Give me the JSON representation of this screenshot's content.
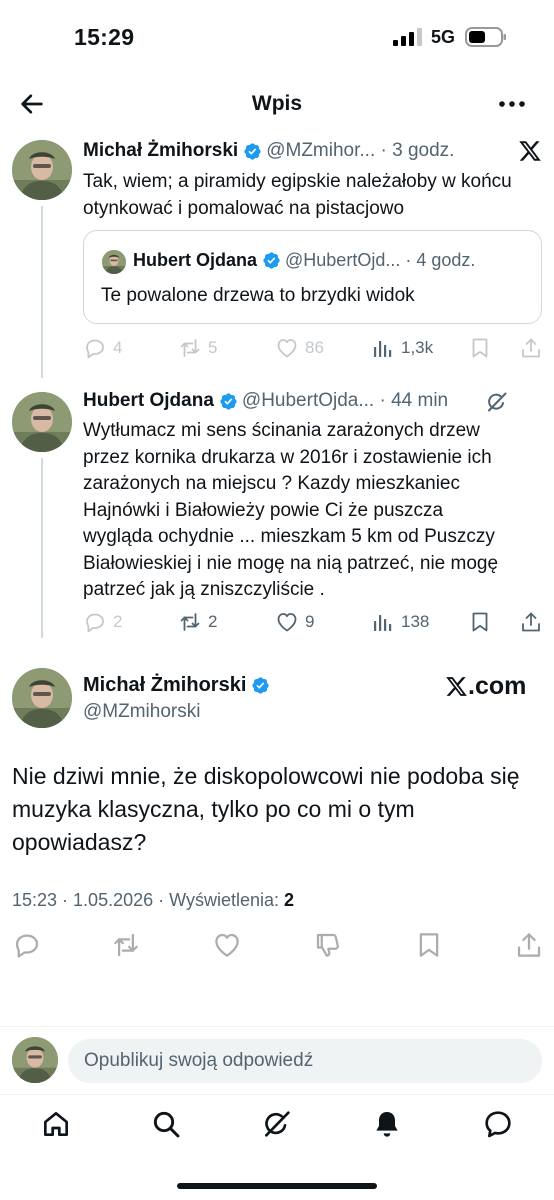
{
  "status_bar": {
    "time": "15:29",
    "network": "5G"
  },
  "header": {
    "title": "Wpis"
  },
  "post1": {
    "author": "Michał Żmihorski",
    "handle_time": "@MZmihor... · 3 godz.",
    "text": "Tak, wiem; a piramidy egipskie należałoby w końcu otynkować i pomalować na pistacjowo",
    "quote": {
      "author": "Hubert Ojdana",
      "handle_time": "@HubertOjd... · 4 godz.",
      "text": "Te powalone drzewa to brzydki widok"
    },
    "counts": {
      "replies": "4",
      "reposts": "5",
      "likes": "86",
      "views": "1,3k"
    }
  },
  "post2": {
    "author": "Hubert Ojdana",
    "handle_time": "@HubertOjda... · 44 min",
    "lines": [
      "Wytłumacz mi sens ścinania zarażonych drzew",
      "przez kornika drukarza w 2016r i zostawienie ich",
      "zarażonych na miejscu ? Kazdy mieszkaniec",
      "Hajnówki i Białowieży powie Ci że puszcza",
      "wygląda ochydnie ... mieszkam 5 km od Puszczy",
      "Białowieskiej i nie mogę na nią patrzeć, nie mogę",
      "patrzeć jak ją zniszczyliście ."
    ],
    "counts": {
      "replies": "2",
      "reposts": "2",
      "likes": "9",
      "views": "138"
    }
  },
  "main_post": {
    "author": "Michał Żmihorski",
    "handle": "@MZmihorski",
    "brand": ".com",
    "lines": [
      "Nie dziwi mnie, że diskopolowcowi nie podoba się",
      "muzyka klasyczna, tylko po co mi o tym",
      "opowiadasz?"
    ],
    "datetime": "15:23 · 1.05.2026 · ",
    "views_label": "Wyświetlenia: ",
    "views_count": "2"
  },
  "reply": {
    "placeholder": "Opublikuj swoją odpowiedź"
  },
  "icons": {
    "back": "arrow-left-icon",
    "more": "more-horizontal-icon",
    "x_logo": "x-logo-icon",
    "verified": "verified-badge-icon",
    "grok": "grok-icon",
    "reply": "reply-icon",
    "repost": "repost-icon",
    "like": "heart-icon",
    "views": "views-icon",
    "bookmark": "bookmark-icon",
    "share": "share-icon",
    "dislike": "dislike-icon",
    "tabs": [
      "home-icon",
      "search-icon",
      "grok-icon",
      "notifications-icon",
      "messages-icon"
    ]
  },
  "colors": {
    "accent": "#1d9bf0",
    "text": "#0f1419",
    "muted": "#536471",
    "border": "#cfd9de"
  }
}
